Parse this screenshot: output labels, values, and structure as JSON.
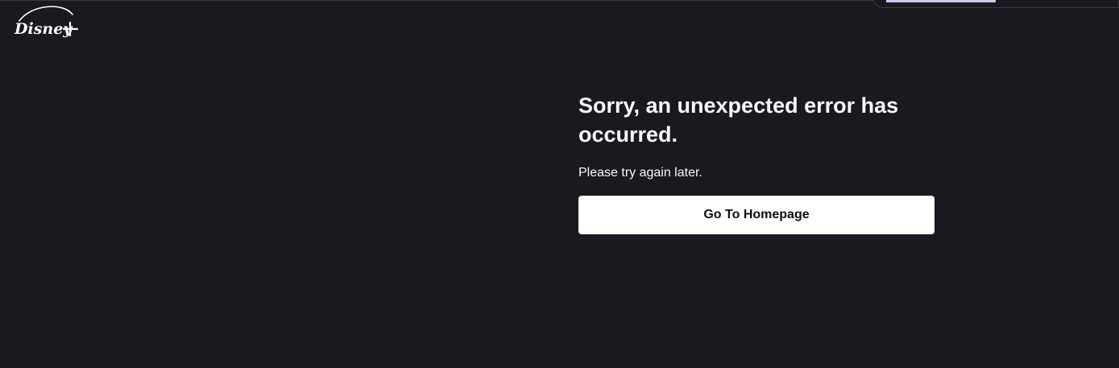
{
  "header": {
    "logo_icon": "disney-plus-logo",
    "logo_text": "Disney+"
  },
  "error": {
    "title": "Sorry, an unexpected error has occurred.",
    "message": "Please try again later.",
    "button_label": "Go To Homepage"
  },
  "colors": {
    "background": "#1a191f",
    "text": "#f9f9f9",
    "button_background": "#ffffff",
    "button_text": "#0e0d12",
    "overlay_accent": "#c9c7ef"
  }
}
